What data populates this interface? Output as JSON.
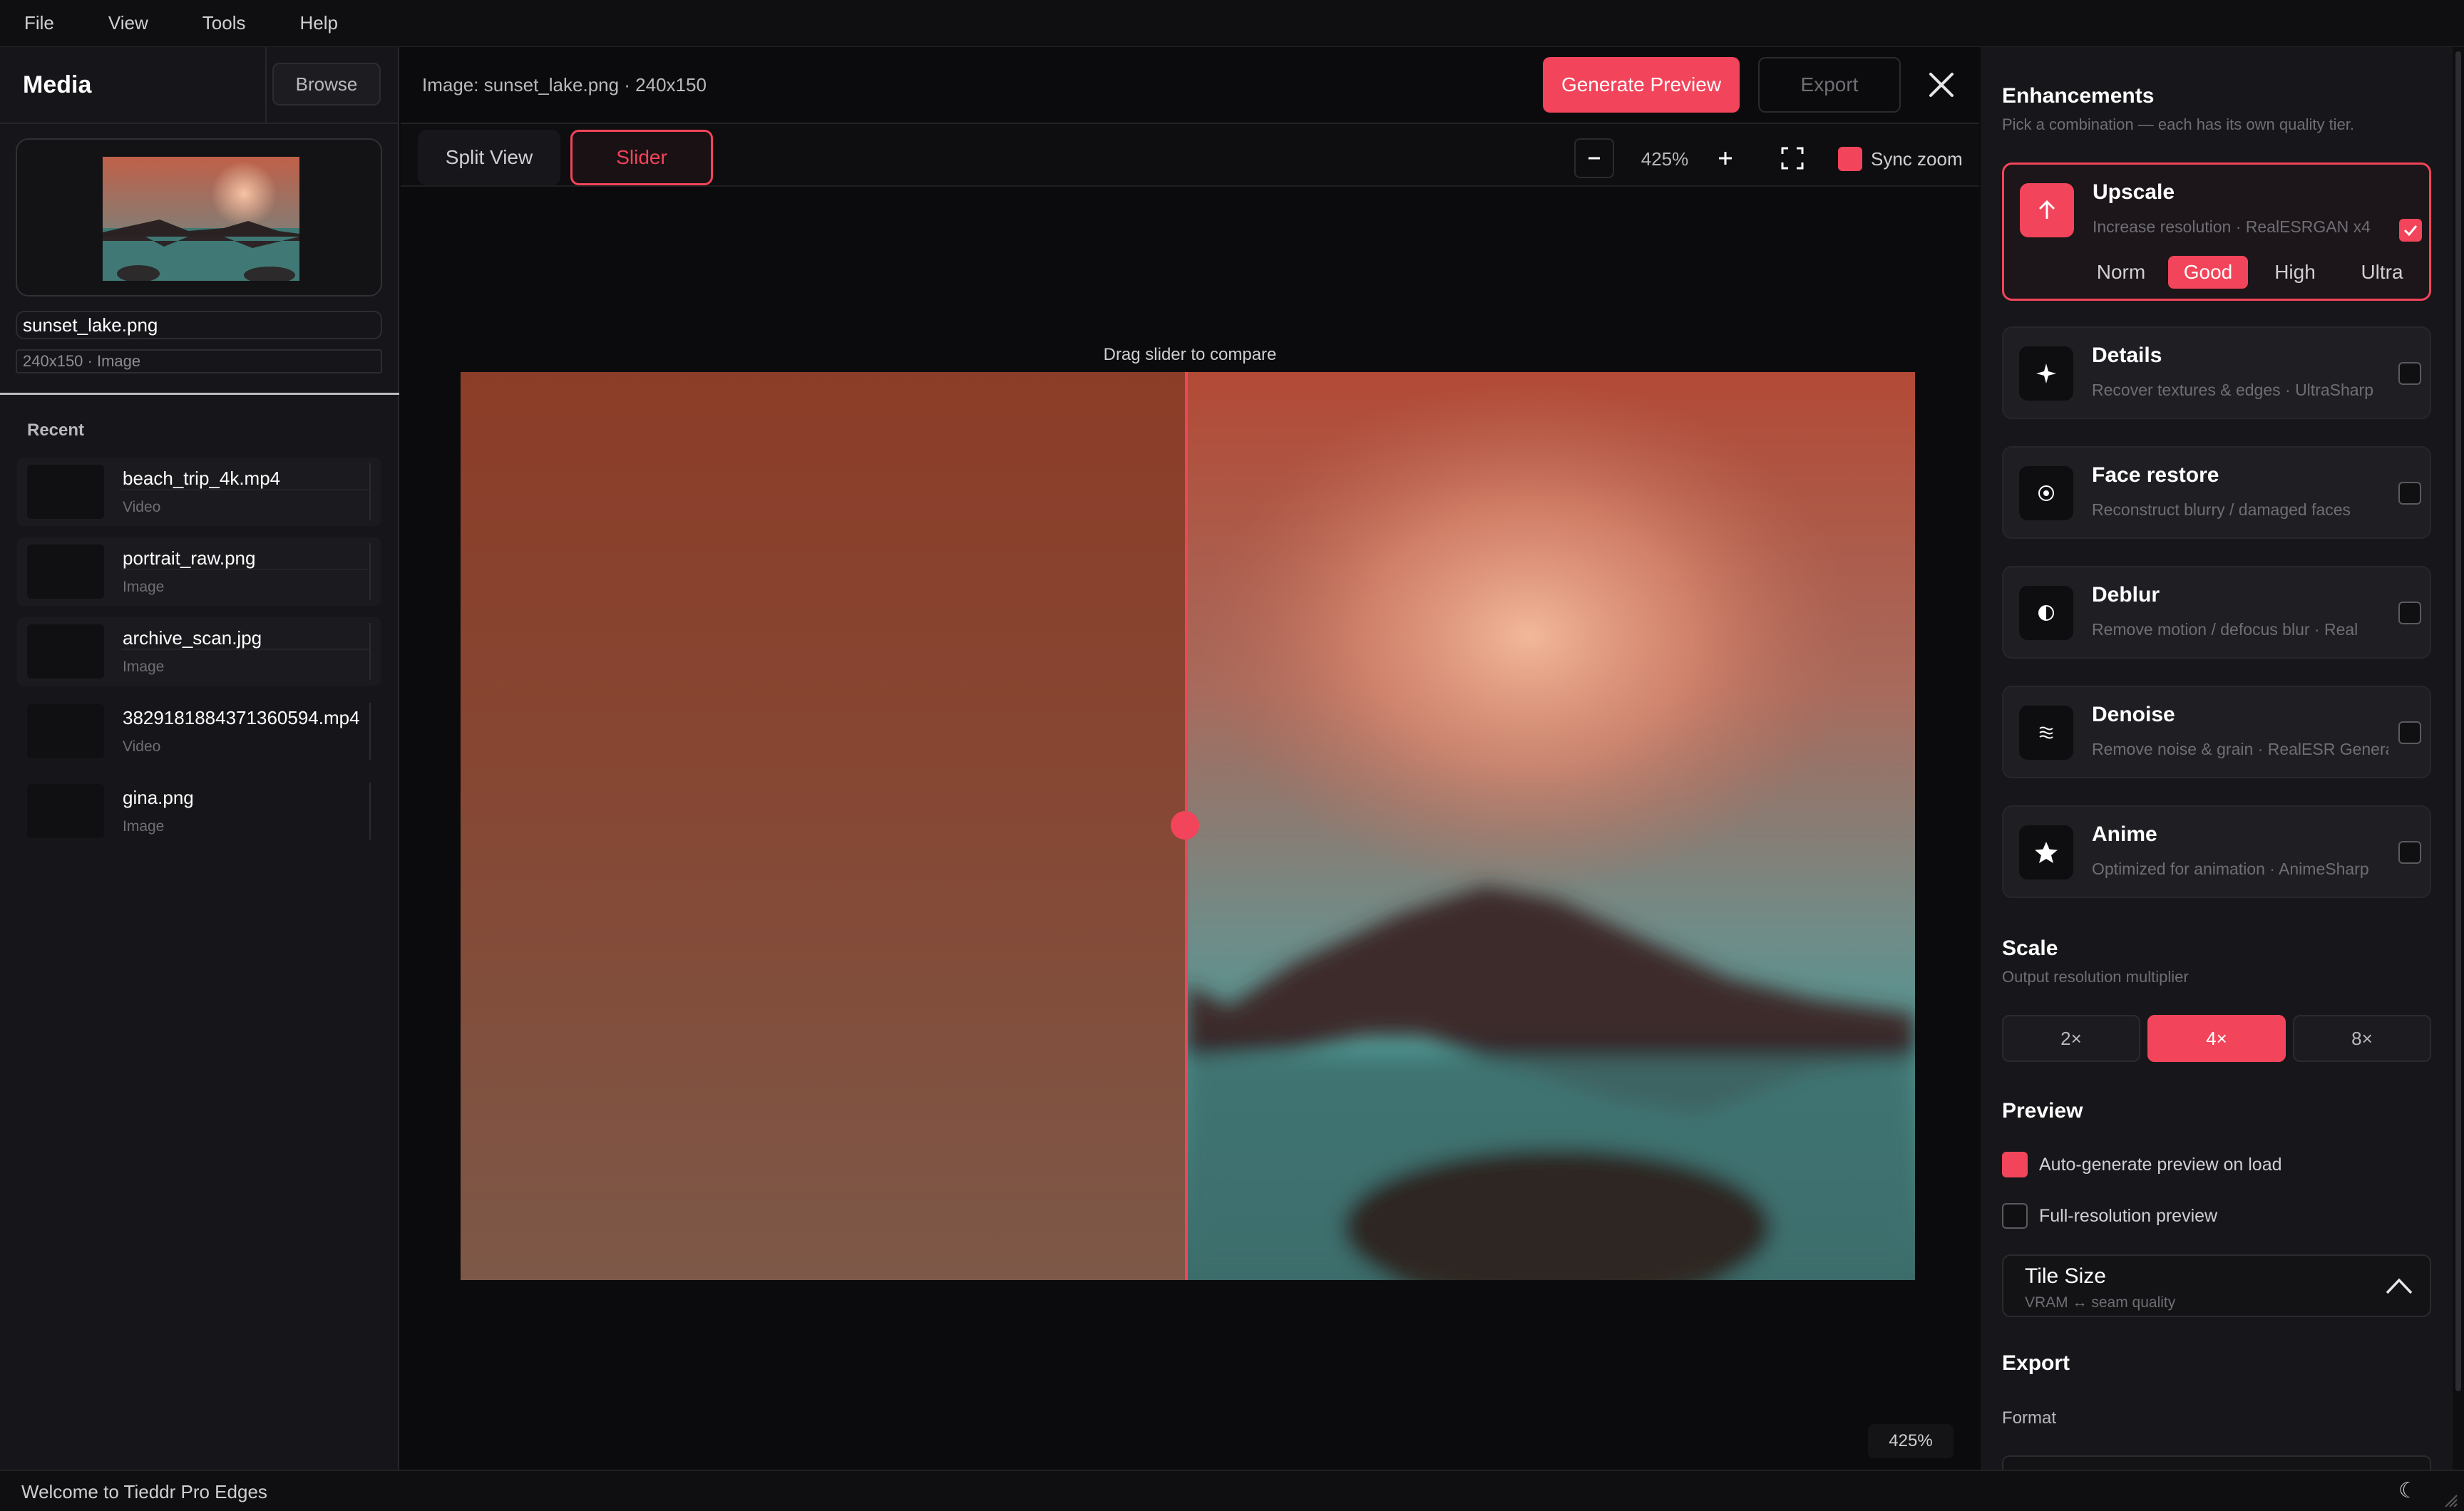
{
  "menu": [
    "File",
    "View",
    "Tools",
    "Help"
  ],
  "media": {
    "title": "Media",
    "browse_label": "Browse",
    "current": {
      "name": "sunset_lake.png",
      "meta": "240x150 · Image"
    },
    "recent_label": "Recent",
    "recent": [
      {
        "name": "beach_trip_4k.mp4",
        "kind": "Video"
      },
      {
        "name": "portrait_raw.png",
        "kind": "Image"
      },
      {
        "name": "archive_scan.jpg",
        "kind": "Image"
      },
      {
        "name": "3829181884371360594.mp4",
        "kind": "Video"
      },
      {
        "name": "gina.png",
        "kind": "Image"
      }
    ]
  },
  "viewer": {
    "image_info": "Image: sunset_lake.png · 240x150",
    "generate_label": "Generate Preview",
    "export_label": "Export",
    "view_modes": [
      "Split View",
      "Slider"
    ],
    "active_view": "Slider",
    "zoom": "425%",
    "sync_zoom_label": "Sync zoom",
    "sync_zoom": true,
    "compare_hint": "Drag slider to compare",
    "zoom_badge": "425%"
  },
  "enhancements": {
    "title": "Enhancements",
    "subtitle": "Pick a combination — each has its own quality tier.",
    "items": [
      {
        "name": "Upscale",
        "desc": "Increase resolution · RealESRGAN x4",
        "icon": "arrow-up-icon",
        "checked": true,
        "selected": true
      },
      {
        "name": "Details",
        "desc": "Recover textures & edges · UltraSharp",
        "icon": "sparkle-icon",
        "checked": false
      },
      {
        "name": "Face restore",
        "desc": "Reconstruct blurry / damaged faces",
        "icon": "face-dot-icon",
        "checked": false
      },
      {
        "name": "Deblur",
        "desc": "Remove motion / defocus blur · Real",
        "icon": "contrast-icon",
        "checked": false
      },
      {
        "name": "Denoise",
        "desc": "Remove noise & grain · RealESR General",
        "icon": "wave-icon",
        "checked": false
      },
      {
        "name": "Anime",
        "desc": "Optimized for animation · AnimeSharp",
        "icon": "star-icon",
        "checked": false
      }
    ],
    "tiers": [
      "Norm",
      "Good",
      "High",
      "Ultra"
    ],
    "active_tier": "Good"
  },
  "scale": {
    "title": "Scale",
    "subtitle": "Output resolution multiplier",
    "options": [
      "2×",
      "4×",
      "8×"
    ],
    "active": "4×"
  },
  "preview": {
    "title": "Preview",
    "auto_label": "Auto-generate preview on load",
    "auto": true,
    "full_label": "Full-resolution preview",
    "full": false
  },
  "tile_size": {
    "title": "Tile Size",
    "subtitle": "VRAM ↔ seam quality"
  },
  "export": {
    "title": "Export",
    "format_label": "Format"
  },
  "status": {
    "text": "Welcome to Tieddr Pro Edges"
  },
  "colors": {
    "accent": "#f2445a",
    "panel": "#17171b",
    "bg": "#0b0b0d"
  }
}
